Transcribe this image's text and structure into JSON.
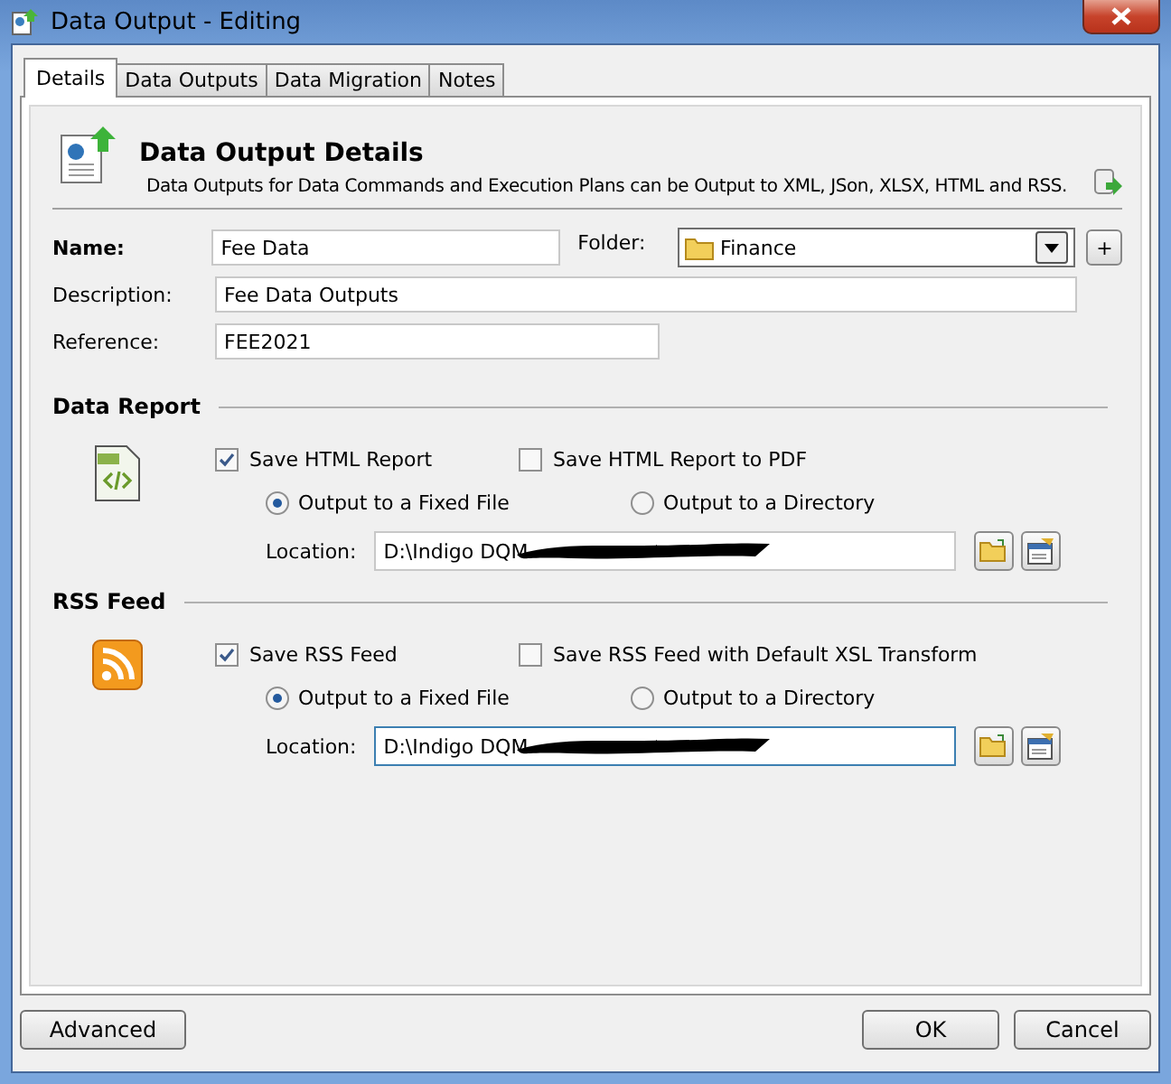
{
  "window": {
    "title": "Data Output - Editing"
  },
  "tabs": [
    {
      "label": "Details",
      "selected": true
    },
    {
      "label": "Data Outputs",
      "selected": false
    },
    {
      "label": "Data Migration",
      "selected": false
    },
    {
      "label": "Notes",
      "selected": false
    }
  ],
  "header": {
    "title": "Data Output Details",
    "description": "Data Outputs for Data Commands and Execution Plans can be Output to XML, JSon, XLSX, HTML and RSS."
  },
  "fields": {
    "name": {
      "label": "Name:",
      "value": "Fee Data"
    },
    "folder": {
      "label": "Folder:",
      "value": "Finance",
      "add": "+"
    },
    "description": {
      "label": "Description:",
      "value": "Fee Data Outputs"
    },
    "reference": {
      "label": "Reference:",
      "value": "FEE2021"
    }
  },
  "sections": [
    {
      "title": "Data Report",
      "kind": "html",
      "checkboxes": [
        {
          "label": "Save HTML Report",
          "checked": true
        },
        {
          "label": "Save HTML Report to PDF",
          "checked": false
        }
      ],
      "radios": [
        {
          "label": "Output to a Fixed File",
          "selected": true
        },
        {
          "label": "Output to a Directory",
          "selected": false
        }
      ],
      "location": {
        "label": "Location:",
        "value": "D:\\Indigo DQM",
        "focused": false
      }
    },
    {
      "title": "RSS Feed",
      "kind": "rss",
      "checkboxes": [
        {
          "label": "Save RSS Feed",
          "checked": true
        },
        {
          "label": "Save RSS Feed with Default XSL Transform",
          "checked": false
        }
      ],
      "radios": [
        {
          "label": "Output to a Fixed File",
          "selected": true
        },
        {
          "label": "Output to a Directory",
          "selected": false
        }
      ],
      "location": {
        "label": "Location:",
        "value": "D:\\Indigo DQM",
        "focused": true
      }
    }
  ],
  "buttons": {
    "left": "Advanced",
    "ok": "OK",
    "cancel": "Cancel"
  }
}
